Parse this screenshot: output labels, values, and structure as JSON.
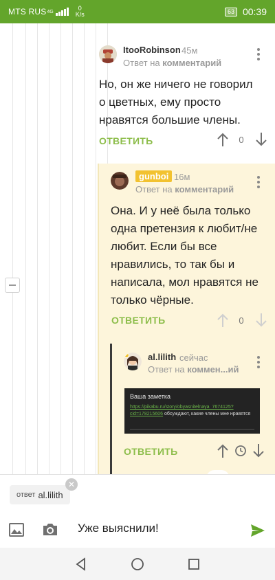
{
  "status_bar": {
    "carrier": "MTS RUS",
    "network": "4G",
    "speed_value": "0",
    "speed_unit": "K/s",
    "battery": "63",
    "time": "00:39"
  },
  "comments": [
    {
      "username": "ItooRobinson",
      "time": "45м",
      "reply_prefix": "Ответ на",
      "reply_target": "комментарий",
      "text": "Но, он же ничего не говорил о цветных, ему просто нравятся большие члены.",
      "reply_label": "ОТВЕТИТЬ",
      "score": "0"
    },
    {
      "username": "gunboi",
      "time": "16м",
      "reply_prefix": "Ответ на",
      "reply_target": "комментарий",
      "text": "Она. И у неё была только одна претензия к любит/не любит. Если бы все нравились, то так бы и написала, мол нравятся не только чёрные.",
      "reply_label": "ОТВЕТИТЬ",
      "score": "0"
    },
    {
      "username": "al.lilith",
      "time": "сейчас",
      "reply_prefix": "Ответ на",
      "reply_target": "коммен...ий",
      "reply_label": "ОТВЕТИТЬ",
      "embed": {
        "title": "Ваша заметка",
        "link": "https://pikabu.ru/story/obyasnitelnaya_7674125?cid=178215606",
        "text": "обсуждают, какие члены мне нравятся"
      }
    }
  ],
  "composer": {
    "chip_prefix": "ответ",
    "chip_name": "al.lilith",
    "input_value": "Уже выяснили!"
  },
  "colors": {
    "brand_green": "#63a52b",
    "reply_green": "#8cbd4a",
    "highlight_bg": "#fdf5db",
    "badge_yellow": "#f2c230"
  }
}
